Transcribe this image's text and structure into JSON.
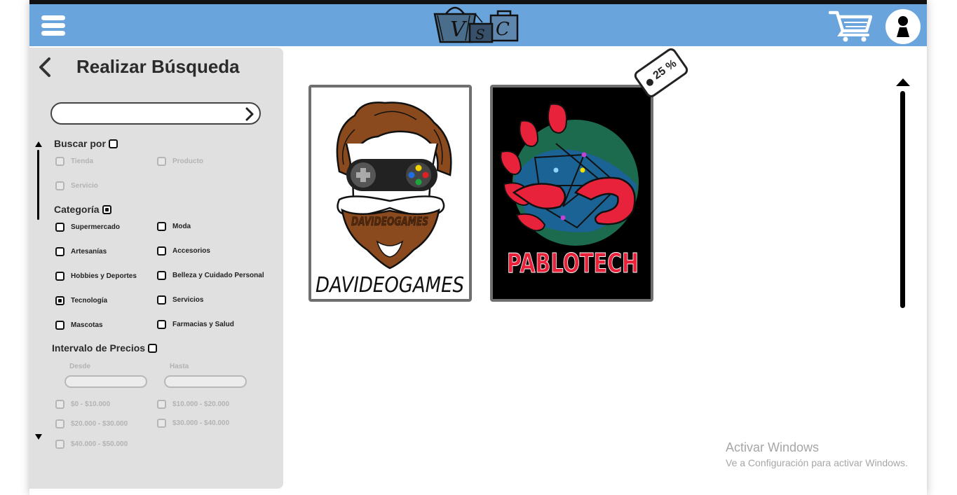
{
  "header": {
    "logo_letters": [
      "V",
      "S",
      "C"
    ]
  },
  "sidebar": {
    "title": "Realizar Búsqueda",
    "search_placeholder": "",
    "buscar_por": {
      "label": "Buscar por",
      "options": [
        "Tienda",
        "Producto",
        "Servicio"
      ]
    },
    "categoria": {
      "label": "Categoría",
      "options_left": [
        "Supermercado",
        "Artesanías",
        "Hobbies y Deportes",
        "Tecnología",
        "Mascotas"
      ],
      "options_right": [
        "Moda",
        "Accesorios",
        "Belleza y Cuidado Personal",
        "Servicios",
        "Farmacias y Salud"
      ],
      "checked": "Tecnología"
    },
    "precios": {
      "label": "Intervalo de Precios",
      "desde": "Desde",
      "hasta": "Hasta",
      "ranges_left": [
        "$0 - $10.000",
        "$20.000 - $30.000",
        "$40.000 - $50.000"
      ],
      "ranges_right": [
        "$10.000 - $20.000",
        "$30.000 - $40.000"
      ]
    }
  },
  "stores": [
    {
      "name": "DAVIDEOGAMES",
      "beard_text": "DAVIDEOGAMES"
    },
    {
      "name": "PABLOTECH",
      "discount": "25 %"
    }
  ],
  "watermark": {
    "title": "Activar Windows",
    "subtitle": "Ve a Configuración para activar Windows."
  },
  "colors": {
    "header": "#69a5dc",
    "sidebar": "#e0e0e0",
    "pablotech_red": "#e8223a"
  }
}
